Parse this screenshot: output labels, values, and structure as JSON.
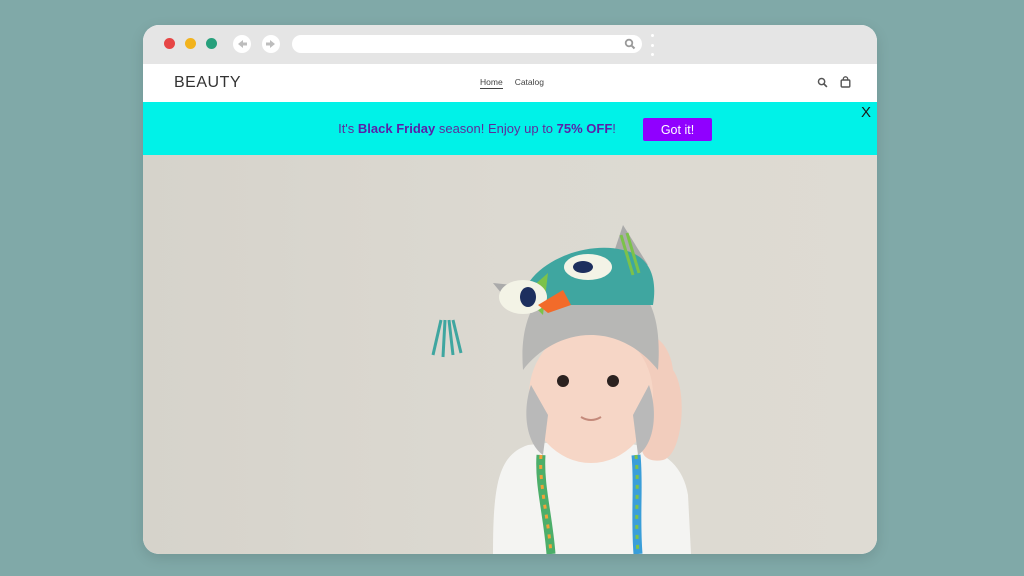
{
  "colors": {
    "page_bg": "#80a9a8",
    "chrome_bg": "#e5e5e5",
    "dot_red": "#e64545",
    "dot_yellow": "#f2b31d",
    "dot_green": "#27a07c",
    "promo_bg": "#00f2e8",
    "promo_text": "#5f2b9a",
    "highlight_text": "#5b1fa8",
    "button_bg": "#9000ff"
  },
  "browser": {
    "icons": [
      "back-arrow-icon",
      "forward-arrow-icon",
      "search-icon",
      "more-icon"
    ]
  },
  "header": {
    "logo": "BEAUTY",
    "nav": [
      {
        "label": "Home",
        "active": true
      },
      {
        "label": "Catalog",
        "active": false
      }
    ],
    "icons": [
      "search-icon",
      "shopping-bag-icon"
    ]
  },
  "promo": {
    "text_before": "It's ",
    "highlight_1": "Black Friday",
    "text_middle": " season! Enjoy up to ",
    "highlight_2": "75% OFF",
    "text_after": "!",
    "button_label": "Got it!",
    "close_label": "X"
  },
  "hero": {
    "image_subject": "baby-wearing-knitted-owl-hat"
  }
}
